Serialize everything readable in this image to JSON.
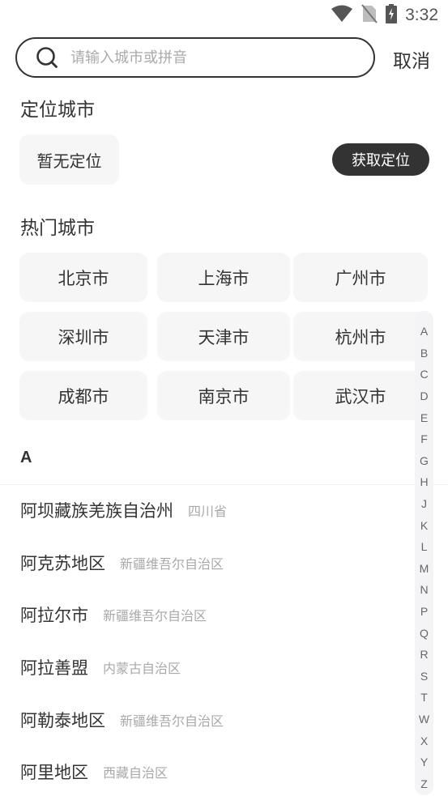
{
  "status_bar": {
    "time": "3:32",
    "icons": [
      "wifi-icon",
      "no-sim-icon",
      "battery-charging-icon"
    ]
  },
  "search": {
    "placeholder": "请输入城市或拼音",
    "value": "",
    "icon": "search-icon",
    "cancel_label": "取消"
  },
  "location": {
    "title": "定位城市",
    "current": "暂无定位",
    "get_button": "获取定位"
  },
  "hot": {
    "title": "热门城市",
    "cities": [
      "北京市",
      "上海市",
      "广州市",
      "深圳市",
      "天津市",
      "杭州市",
      "成都市",
      "南京市",
      "武汉市"
    ]
  },
  "list": {
    "current_letter": "A",
    "items": [
      {
        "name": "阿坝藏族羌族自治州",
        "province": "四川省"
      },
      {
        "name": "阿克苏地区",
        "province": "新疆维吾尔自治区"
      },
      {
        "name": "阿拉尔市",
        "province": "新疆维吾尔自治区"
      },
      {
        "name": "阿拉善盟",
        "province": "内蒙古自治区"
      },
      {
        "name": "阿勒泰地区",
        "province": "新疆维吾尔自治区"
      },
      {
        "name": "阿里地区",
        "province": "西藏自治区"
      }
    ]
  },
  "index_bar": {
    "letters": [
      "A",
      "B",
      "C",
      "D",
      "E",
      "F",
      "G",
      "H",
      "J",
      "K",
      "L",
      "M",
      "N",
      "P",
      "Q",
      "R",
      "S",
      "T",
      "W",
      "X",
      "Y",
      "Z"
    ]
  }
}
